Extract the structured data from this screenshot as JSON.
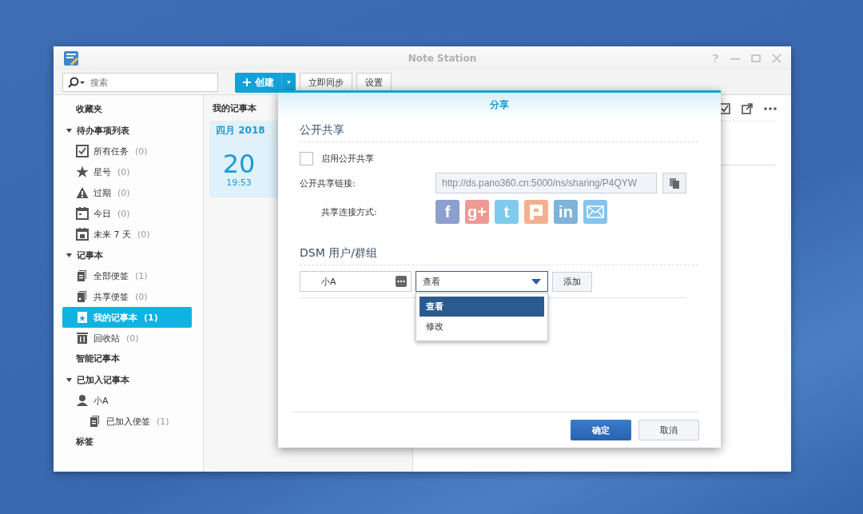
{
  "window": {
    "title": "Note Station"
  },
  "toolbar": {
    "search": {
      "placeholder": "搜索"
    },
    "create_button": "创建",
    "sync_button": "立即同步",
    "settings_button": "设置"
  },
  "sidebar": [
    {
      "kind": "section",
      "label": "收藏夹"
    },
    {
      "kind": "group",
      "label": "待办事项列表",
      "expanded": true,
      "children": [
        {
          "label": "所有任务",
          "count": "(0)",
          "selected": false
        },
        {
          "label": "星号",
          "count": "(0)",
          "selected": false
        },
        {
          "label": "过期",
          "count": "(0)",
          "selected": false
        },
        {
          "label": "今日",
          "count": "(0)",
          "selected": false
        },
        {
          "label": "未来 7 天",
          "count": "(0)",
          "selected": false
        }
      ]
    },
    {
      "kind": "group",
      "label": "记事本",
      "expanded": true,
      "children": [
        {
          "label": "全部便签",
          "count": "(1)",
          "selected": false
        },
        {
          "label": "共享便签",
          "count": "(0)",
          "selected": false
        },
        {
          "label": "我的记事本",
          "count": "(1)",
          "selected": true
        },
        {
          "label": "回收站",
          "count": "(0)",
          "selected": false
        }
      ]
    },
    {
      "kind": "section",
      "label": "智能记事本"
    },
    {
      "kind": "group",
      "label": "已加入记事本",
      "expanded": true,
      "children": [
        {
          "label": "小A",
          "selected": false,
          "children": [
            {
              "label": "已加入便签",
              "count": "(1)",
              "selected": false
            }
          ]
        }
      ]
    },
    {
      "kind": "section",
      "label": "标签"
    }
  ],
  "note_list": {
    "title": "我的记事本",
    "month": "四月 2018",
    "notes": [
      {
        "day": "20",
        "time": "19:53",
        "selected": true
      }
    ]
  },
  "dialog": {
    "title": "分享",
    "public_section": {
      "heading": "公开共享",
      "enable": {
        "label": "启用公开共享",
        "checked": false
      },
      "link_label": "公开共享链接:",
      "link_value": "http://ds.pano360.cn:5000/ns/sharing/P4QYW",
      "share_label": "共享连接方式:",
      "share_buttons": [
        {
          "kind": "glyph",
          "glyph": "f",
          "color": "#8c9fce"
        },
        {
          "kind": "glyph",
          "glyph": "g+",
          "color": "#ee9a92"
        },
        {
          "kind": "glyph",
          "glyph": "t",
          "color": "#7fcbee"
        },
        {
          "kind": "box",
          "color": "#f3b08f"
        },
        {
          "kind": "glyph",
          "glyph": "in",
          "color": "#7fb3d8"
        },
        {
          "kind": "mail",
          "color": "#86c4ee"
        }
      ]
    },
    "users_section": {
      "heading": "DSM 用户/群组",
      "user_value": "小A",
      "permission_value": "查看",
      "add_button": "添加",
      "menu": [
        {
          "label": "查看",
          "selected": true
        },
        {
          "label": "修改",
          "selected": false
        }
      ]
    },
    "ok_button": "确定",
    "cancel_button": "取消"
  }
}
